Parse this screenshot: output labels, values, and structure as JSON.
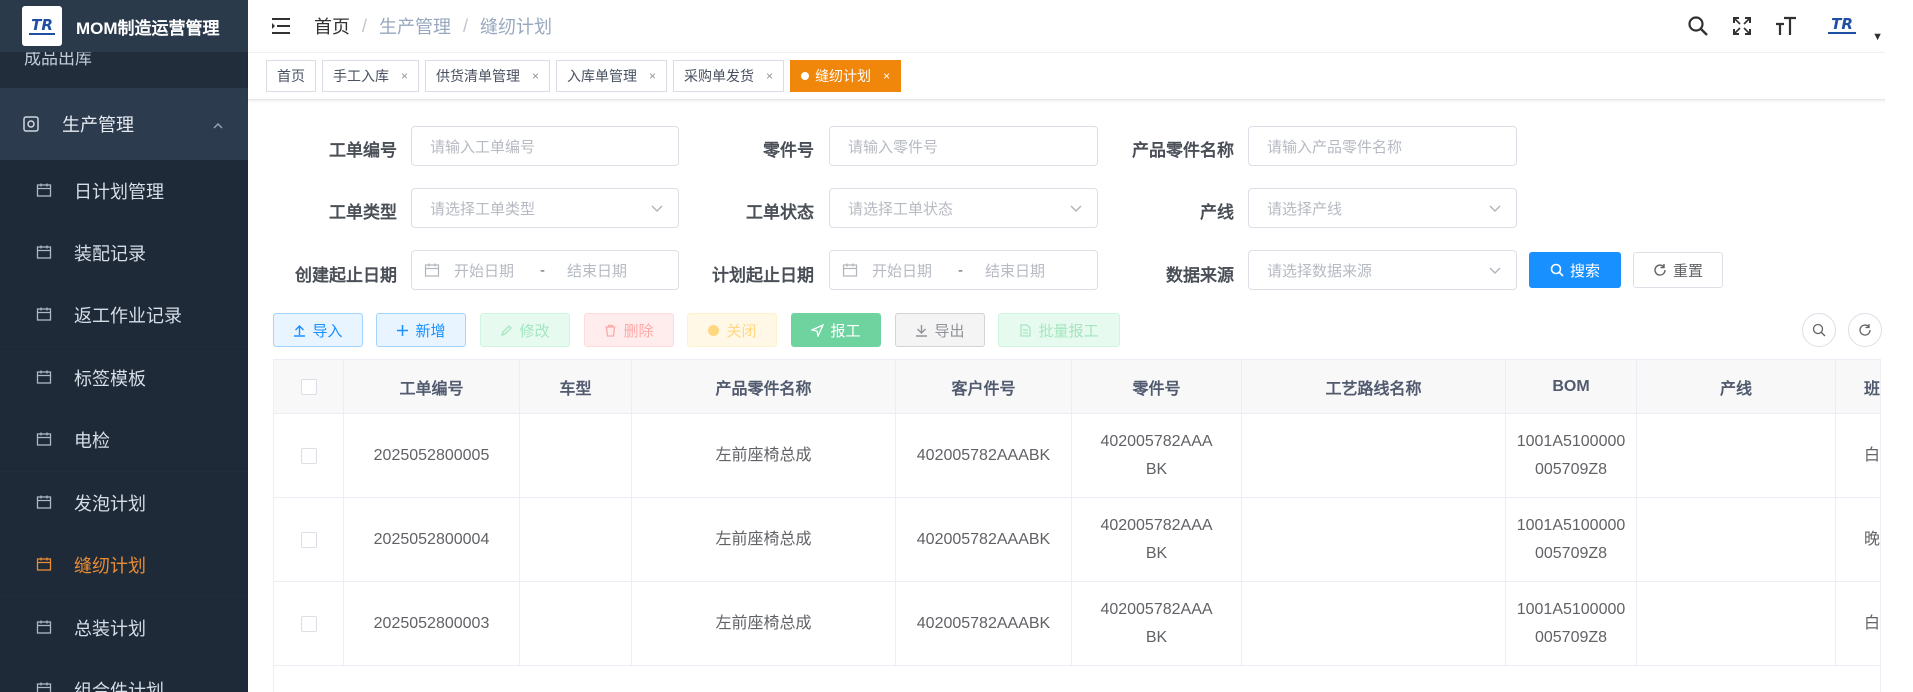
{
  "app": {
    "title": "MOM制造运营管理",
    "logo_text": "TR"
  },
  "sidebar": {
    "hidden_item": "成品出库",
    "group": "生产管理",
    "items": [
      {
        "label": "日计划管理",
        "active": false
      },
      {
        "label": "装配记录",
        "active": false
      },
      {
        "label": "返工作业记录",
        "active": false
      },
      {
        "label": "标签模板",
        "active": false
      },
      {
        "label": "电检",
        "active": false
      },
      {
        "label": "发泡计划",
        "active": false
      },
      {
        "label": "缝纫计划",
        "active": true
      },
      {
        "label": "总装计划",
        "active": false
      },
      {
        "label": "组合件计划",
        "active": false
      }
    ]
  },
  "breadcrumb": {
    "home": "首页",
    "section": "生产管理",
    "current": "缝纫计划",
    "sep": "/"
  },
  "tags": [
    {
      "label": "首页",
      "closable": false,
      "active": false
    },
    {
      "label": "手工入库",
      "closable": true,
      "active": false
    },
    {
      "label": "供货清单管理",
      "closable": true,
      "active": false
    },
    {
      "label": "入库单管理",
      "closable": true,
      "active": false
    },
    {
      "label": "采购单发货",
      "closable": true,
      "active": false
    },
    {
      "label": "缝纫计划",
      "closable": true,
      "active": true
    }
  ],
  "tag_close": "×",
  "form": {
    "work_order_no": {
      "label": "工单编号",
      "placeholder": "请输入工单编号"
    },
    "part_no": {
      "label": "零件号",
      "placeholder": "请输入零件号"
    },
    "product_part_name": {
      "label": "产品零件名称",
      "placeholder": "请输入产品零件名称"
    },
    "work_order_type": {
      "label": "工单类型",
      "placeholder": "请选择工单类型"
    },
    "work_order_status": {
      "label": "工单状态",
      "placeholder": "请选择工单状态"
    },
    "line": {
      "label": "产线",
      "placeholder": "请选择产线"
    },
    "create_date": {
      "label": "创建起止日期",
      "start": "开始日期",
      "sep": "-",
      "end": "结束日期"
    },
    "plan_date": {
      "label": "计划起止日期",
      "start": "开始日期",
      "sep": "-",
      "end": "结束日期"
    },
    "data_source": {
      "label": "数据来源",
      "placeholder": "请选择数据来源"
    },
    "search_label": "搜索",
    "reset_label": "重置"
  },
  "toolbar": {
    "import": "导入",
    "add": "新增",
    "edit": "修改",
    "delete": "删除",
    "close": "关闭",
    "report": "报工",
    "export": "导出",
    "batch_report": "批量报工"
  },
  "table": {
    "columns": [
      "工单编号",
      "车型",
      "产品零件名称",
      "客户件号",
      "零件号",
      "工艺路线名称",
      "BOM",
      "产线",
      "班次"
    ],
    "rows": [
      {
        "work_order_no": "2025052800005",
        "car_model": "",
        "product_name": "左前座椅总成",
        "customer_part_no": "402005782AAABK",
        "part_no": "402005782AAABK",
        "route_name": "",
        "bom": "1001A5100000005709Z8",
        "line": "",
        "shift": "白班"
      },
      {
        "work_order_no": "2025052800004",
        "car_model": "",
        "product_name": "左前座椅总成",
        "customer_part_no": "402005782AAABK",
        "part_no": "402005782AAABK",
        "route_name": "",
        "bom": "1001A5100000005709Z8",
        "line": "",
        "shift": "晚班"
      },
      {
        "work_order_no": "2025052800003",
        "car_model": "",
        "product_name": "左前座椅总成",
        "customer_part_no": "402005782AAABK",
        "part_no": "402005782AAABK",
        "route_name": "",
        "bom": "1001A5100000005709Z8",
        "line": "",
        "shift": "白班"
      }
    ]
  },
  "colors": {
    "sidebar_bg": "#222d3c",
    "active_menu": "#e98d35",
    "active_tag": "#f0860a",
    "primary": "#1890ff"
  }
}
